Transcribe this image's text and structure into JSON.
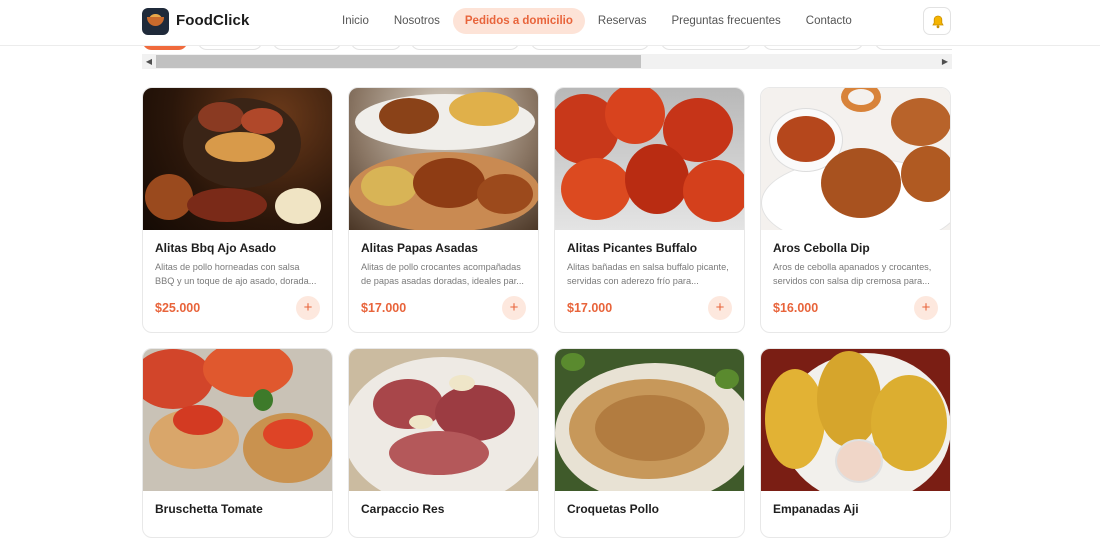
{
  "brand": {
    "name": "FoodClick"
  },
  "nav": [
    {
      "label": "Inicio"
    },
    {
      "label": "Nosotros"
    },
    {
      "label": "Pedidos a domicilio"
    },
    {
      "label": "Reservas"
    },
    {
      "label": "Preguntas frecuentes"
    },
    {
      "label": "Contacto"
    }
  ],
  "nav_active_index": 2,
  "icons": {
    "notifications": "bell-icon",
    "add": "plus-icon",
    "scroll_left": "triangle-left-icon",
    "scroll_right": "triangle-right-icon"
  },
  "colors": {
    "accent": "#e8643b",
    "accent_soft": "#fde3d7"
  },
  "products": [
    {
      "name": "Alitas Bbq Ajo Asado",
      "description": "Alitas de pollo horneadas con salsa BBQ y un toque de ajo asado, dorada...",
      "price": "$25.000",
      "add_label": "+"
    },
    {
      "name": "Alitas Papas Asadas",
      "description": "Alitas de pollo crocantes acompañadas de papas asadas doradas, ideales par...",
      "price": "$17.000",
      "add_label": "+"
    },
    {
      "name": "Alitas Picantes Buffalo",
      "description": "Alitas bañadas en salsa buffalo picante, servidas con aderezo frío para...",
      "price": "$17.000",
      "add_label": "+"
    },
    {
      "name": "Aros Cebolla Dip",
      "description": "Aros de cebolla apanados y crocantes, servidos con salsa dip cremosa para...",
      "price": "$16.000",
      "add_label": "+"
    },
    {
      "name": "Bruschetta Tomate"
    },
    {
      "name": "Carpaccio Res"
    },
    {
      "name": "Croquetas Pollo"
    },
    {
      "name": "Empanadas Aji"
    }
  ]
}
